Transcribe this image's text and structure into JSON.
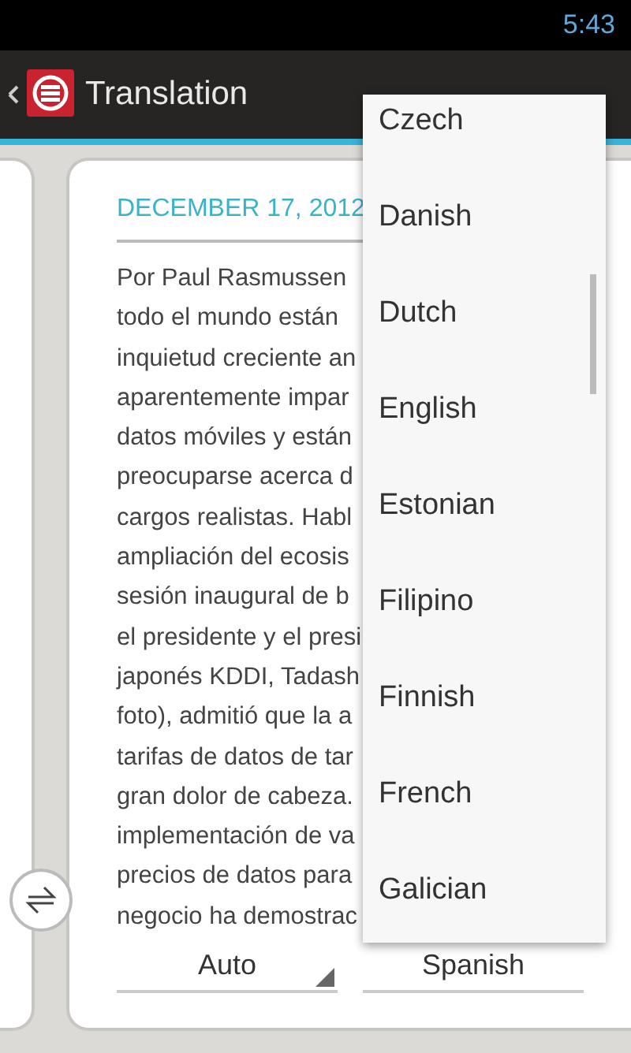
{
  "status_bar": {
    "time": "5:43"
  },
  "action_bar": {
    "title": "Translation"
  },
  "article": {
    "date": "DECEMBER 17, 2012",
    "lines": [
      "Por Paul Rasmussen",
      "todo el mundo están",
      "inquietud creciente an",
      "aparentemente impar",
      "datos móviles y están",
      "preocuparse acerca d",
      "cargos realistas. Habl",
      "ampliación del ecosis",
      "sesión inaugural de b",
      "el presidente y el presi",
      "japonés KDDI, Tadash",
      "foto), admitió que la a",
      "tarifas de datos de tar",
      "gran dolor de cabeza.",
      "implementación de va",
      "precios de datos para",
      "negocio ha demostrac"
    ]
  },
  "languages": {
    "source": "Auto",
    "target": "Spanish"
  },
  "dropdown": {
    "items": [
      "Czech",
      "Danish",
      "Dutch",
      "English",
      "Estonian",
      "Filipino",
      "Finnish",
      "French",
      "Galician"
    ]
  }
}
